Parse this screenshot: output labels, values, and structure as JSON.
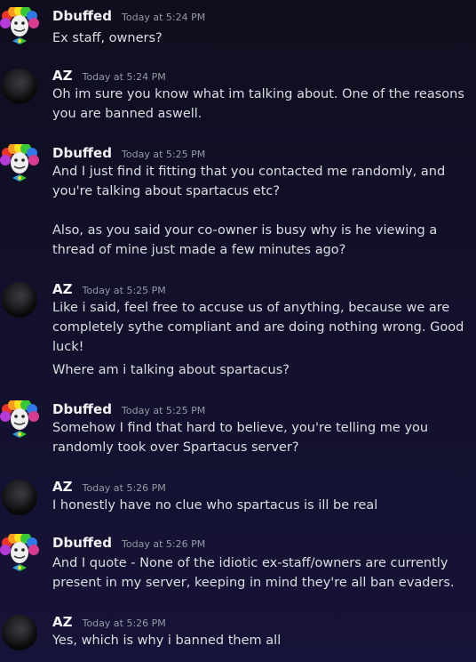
{
  "colors": {
    "background": "#12102a",
    "username": "#f2f3f5",
    "timestamp": "#949ba4",
    "text": "#dbdee1"
  },
  "messages": [
    {
      "author": "Dbuffed",
      "avatar": "clown-avatar",
      "time": "Today at 5:24 PM",
      "lines": [
        "Ex staff, owners?"
      ]
    },
    {
      "author": "AZ",
      "avatar": "dark-avatar",
      "time": "Today at 5:24 PM",
      "lines": [
        "Oh im sure you know what im talking about. One of the reasons",
        "you are banned aswell."
      ]
    },
    {
      "author": "Dbuffed",
      "avatar": "clown-avatar",
      "time": "Today at 5:25 PM",
      "lines": [
        "And I just find it fitting that you contacted me randomly, and",
        "you're talking about spartacus etc?",
        "Also, as you said your co-owner is busy why is he viewing a",
        "thread of mine just made a few minutes ago?"
      ]
    },
    {
      "author": "AZ",
      "avatar": "dark-avatar",
      "time": "Today at 5:25 PM",
      "lines": [
        "Like i said, feel free to accuse us of anything, because we are",
        "completely sythe compliant and are doing nothing wrong. Good",
        "luck!",
        "Where am i talking about spartacus?"
      ]
    },
    {
      "author": "Dbuffed",
      "avatar": "clown-avatar",
      "time": "Today at 5:25 PM",
      "lines": [
        "Somehow I find that hard to believe, you're telling me you",
        "randomly took over Spartacus server?"
      ]
    },
    {
      "author": "AZ",
      "avatar": "dark-avatar",
      "time": "Today at 5:26 PM",
      "lines": [
        "I honestly have no clue who spartacus is ill be real"
      ]
    },
    {
      "author": "Dbuffed",
      "avatar": "clown-avatar",
      "time": "Today at 5:26 PM",
      "lines": [
        "And I quote -  None of the idiotic ex-staff/owners are currently",
        "present in my server, keeping in mind they're all ban evaders."
      ]
    },
    {
      "author": "AZ",
      "avatar": "dark-avatar",
      "time": "Today at 5:26 PM",
      "lines": [
        "Yes, which is why i banned them all"
      ]
    }
  ]
}
